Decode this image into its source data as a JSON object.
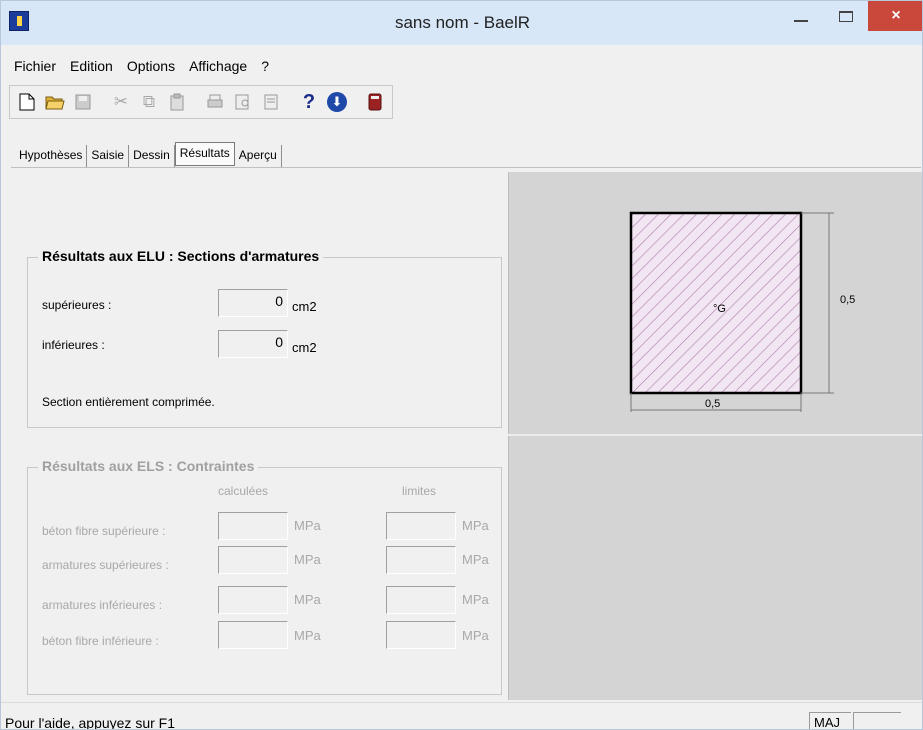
{
  "window": {
    "title": "sans nom - BaelR"
  },
  "title_buttons": {
    "close": "×"
  },
  "menu": [
    "Fichier",
    "Edition",
    "Options",
    "Affichage",
    "?"
  ],
  "toolbar": {
    "new": "new-document-icon",
    "open": "open-folder-icon",
    "save": "save-icon",
    "cut": "cut-icon",
    "copy": "copy-icon",
    "paste": "paste-icon",
    "print": "print-icon",
    "print_preview": "print-preview-icon",
    "page_setup": "page-setup-icon",
    "help": "?",
    "update": "update-icon",
    "calculate": "calculator-icon"
  },
  "tabs": [
    "Hypothèses",
    "Saisie",
    "Dessin",
    "Résultats",
    "Aperçu"
  ],
  "active_tab": "Résultats",
  "elu": {
    "title": "Résultats aux ELU : Sections d'armatures",
    "sup_label": "supérieures :",
    "sup_value": "0",
    "inf_label": "inférieures :",
    "inf_value": "0",
    "unit": "cm2",
    "message": "Section entièrement comprimée."
  },
  "els": {
    "title": "Résultats aux ELS : Contraintes",
    "col_calc": "calculées",
    "col_lim": "limites",
    "rows": [
      {
        "label": "béton fibre supérieure :",
        "unit": "MPa"
      },
      {
        "label": "armatures supérieures :",
        "unit": "MPa"
      },
      {
        "label": "armatures inférieures :",
        "unit": "MPa"
      },
      {
        "label": "béton fibre inférieure :",
        "unit": "MPa"
      }
    ]
  },
  "drawing": {
    "center_label": "°G",
    "width_label": "0,5",
    "height_label": "0,5",
    "hatch_color": "#b48ab4",
    "fill_color": "#f3e6f3"
  },
  "status": {
    "help_text": "Pour l'aide, appuyez sur F1",
    "maj": "MAJ"
  }
}
